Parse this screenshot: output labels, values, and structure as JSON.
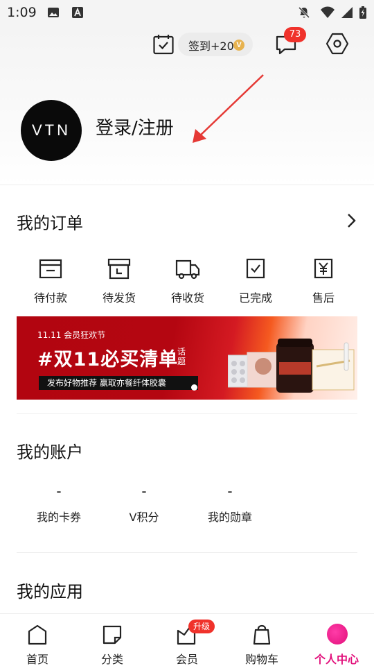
{
  "status_bar": {
    "time": "1:09",
    "icons": [
      "image-icon",
      "text-a-icon",
      "mute-icon",
      "wifi-icon",
      "signal-icon",
      "battery-icon"
    ]
  },
  "header": {
    "sign_in_label": "签到+20",
    "sign_in_badge": "V",
    "message_count": "73",
    "avatar_text": "VTN",
    "login_text": "登录/注册"
  },
  "orders": {
    "title": "我的订单",
    "items": [
      {
        "label": "待付款",
        "icon": "wallet-icon"
      },
      {
        "label": "待发货",
        "icon": "package-icon"
      },
      {
        "label": "待收货",
        "icon": "truck-icon"
      },
      {
        "label": "已完成",
        "icon": "checklist-icon"
      },
      {
        "label": "售后",
        "icon": "yen-receipt-icon"
      }
    ]
  },
  "banner": {
    "subtitle": "11.11 会员狂欢节",
    "title": "#双11必买清单",
    "tag": "话题",
    "bar_text": "发布好物推荐 赢取亦餐纤体胶囊"
  },
  "account": {
    "title": "我的账户",
    "items": [
      {
        "value": "-",
        "label": "我的卡券"
      },
      {
        "value": "-",
        "label": "V积分"
      },
      {
        "value": "-",
        "label": "我的勋章"
      }
    ]
  },
  "apps": {
    "title": "我的应用"
  },
  "nav": {
    "items": [
      {
        "label": "首页",
        "icon": "home-icon"
      },
      {
        "label": "分类",
        "icon": "category-icon"
      },
      {
        "label": "会员",
        "icon": "vip-crown-icon",
        "badge": "升级"
      },
      {
        "label": "购物车",
        "icon": "shopping-bag-icon"
      },
      {
        "label": "个人中心",
        "icon": "profile-dot-icon",
        "active": true
      }
    ]
  },
  "colors": {
    "accent": "#e2107b",
    "badge_red": "#f0322b",
    "banner_red": "#b20510"
  }
}
